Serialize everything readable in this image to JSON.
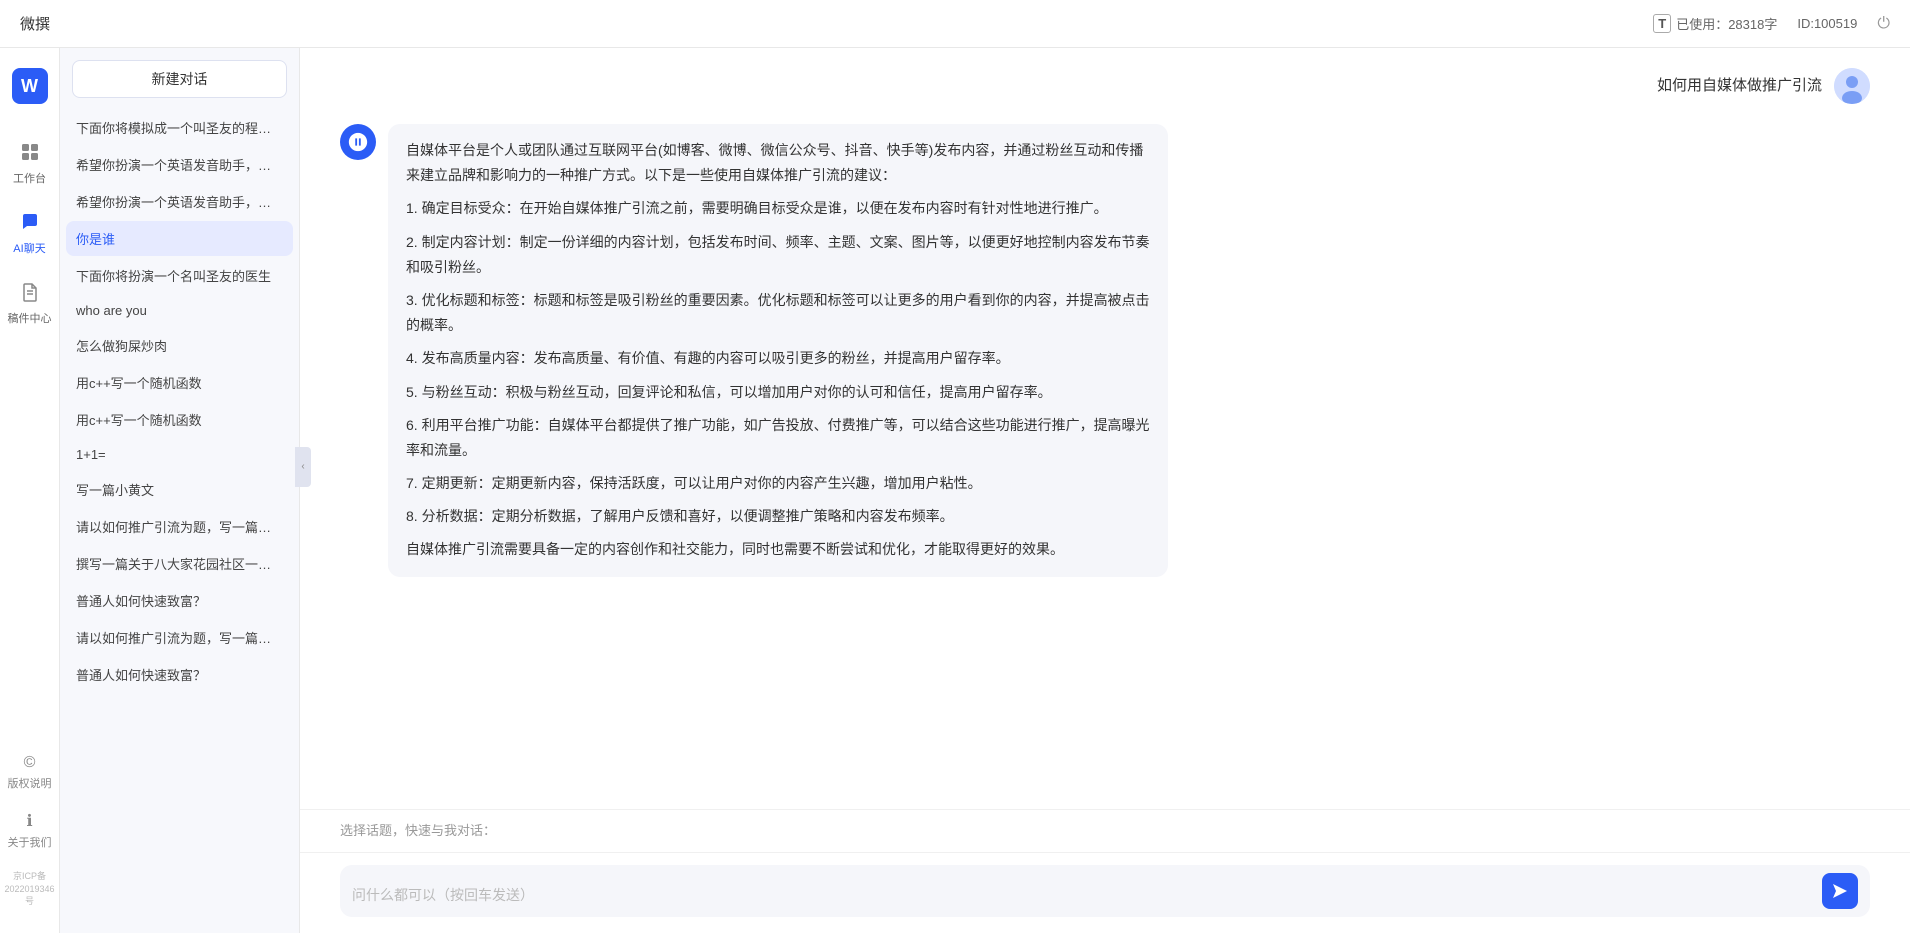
{
  "topbar": {
    "title": "微撰",
    "usage_label": "已使用：28318字",
    "usage_icon": "T",
    "id_label": "ID:100519",
    "logout_symbol": "⏻"
  },
  "logo": {
    "symbol": "W",
    "app_name": "微撰"
  },
  "nav": {
    "items": [
      {
        "id": "workspace",
        "icon": "⊞",
        "label": "工作台"
      },
      {
        "id": "ai-chat",
        "icon": "💬",
        "label": "AI聊天"
      },
      {
        "id": "drafts",
        "icon": "📄",
        "label": "稿件中心"
      }
    ],
    "bottom_items": [
      {
        "id": "copyright",
        "icon": "©",
        "label": "版权说明"
      },
      {
        "id": "about",
        "icon": "ℹ",
        "label": "关于我们"
      }
    ],
    "icp": "京ICP备2022019346号"
  },
  "sidebar": {
    "new_chat_label": "新建对话",
    "chat_items": [
      {
        "id": "chat1",
        "label": "下面你将模拟成一个叫圣友的程序员，我说..."
      },
      {
        "id": "chat2",
        "label": "希望你扮演一个英语发音助手，我提供给你..."
      },
      {
        "id": "chat3",
        "label": "希望你扮演一个英语发音助手，我提供给你..."
      },
      {
        "id": "chat4",
        "label": "你是谁",
        "active": true
      },
      {
        "id": "chat5",
        "label": "下面你将扮演一个名叫圣友的医生"
      },
      {
        "id": "chat6",
        "label": "who are you"
      },
      {
        "id": "chat7",
        "label": "怎么做狗屎炒肉"
      },
      {
        "id": "chat8",
        "label": "用c++写一个随机函数"
      },
      {
        "id": "chat9",
        "label": "用c++写一个随机函数"
      },
      {
        "id": "chat10",
        "label": "1+1="
      },
      {
        "id": "chat11",
        "label": "写一篇小黄文"
      },
      {
        "id": "chat12",
        "label": "请以如何推广引流为题，写一篇大纲"
      },
      {
        "id": "chat13",
        "label": "撰写一篇关于八大家花园社区一刻钟便民生..."
      },
      {
        "id": "chat14",
        "label": "普通人如何快速致富？"
      },
      {
        "id": "chat15",
        "label": "请以如何推广引流为题，写一篇大纲"
      },
      {
        "id": "chat16",
        "label": "普通人如何快速致富？"
      }
    ]
  },
  "chat": {
    "messages": [
      {
        "id": "msg1",
        "role": "user",
        "text": "如何用自媒体做推广引流",
        "avatar_type": "user"
      },
      {
        "id": "msg2",
        "role": "ai",
        "paragraphs": [
          "自媒体平台是个人或团队通过互联网平台(如博客、微博、微信公众号、抖音、快手等)发布内容，并通过粉丝互动和传播来建立品牌和影响力的一种推广方式。以下是一些使用自媒体推广引流的建议：",
          "1. 确定目标受众：在开始自媒体推广引流之前，需要明确目标受众是谁，以便在发布内容时有针对性地进行推广。",
          "2. 制定内容计划：制定一份详细的内容计划，包括发布时间、频率、主题、文案、图片等，以便更好地控制内容发布节奏和吸引粉丝。",
          "3. 优化标题和标签：标题和标签是吸引粉丝的重要因素。优化标题和标签可以让更多的用户看到你的内容，并提高被点击的概率。",
          "4. 发布高质量内容：发布高质量、有价值、有趣的内容可以吸引更多的粉丝，并提高用户留存率。",
          "5. 与粉丝互动：积极与粉丝互动，回复评论和私信，可以增加用户对你的认可和信任，提高用户留存率。",
          "6. 利用平台推广功能：自媒体平台都提供了推广功能，如广告投放、付费推广等，可以结合这些功能进行推广，提高曝光率和流量。",
          "7. 定期更新：定期更新内容，保持活跃度，可以让用户对你的内容产生兴趣，增加用户粘性。",
          "8. 分析数据：定期分析数据，了解用户反馈和喜好，以便调整推广策略和内容发布频率。",
          "自媒体推广引流需要具备一定的内容创作和社交能力，同时也需要不断尝试和优化，才能取得更好的效果。"
        ],
        "avatar_type": "ai"
      }
    ],
    "quick_replies_label": "选择话题，快速与我对话：",
    "input_placeholder": "问什么都可以（按回车发送）"
  }
}
